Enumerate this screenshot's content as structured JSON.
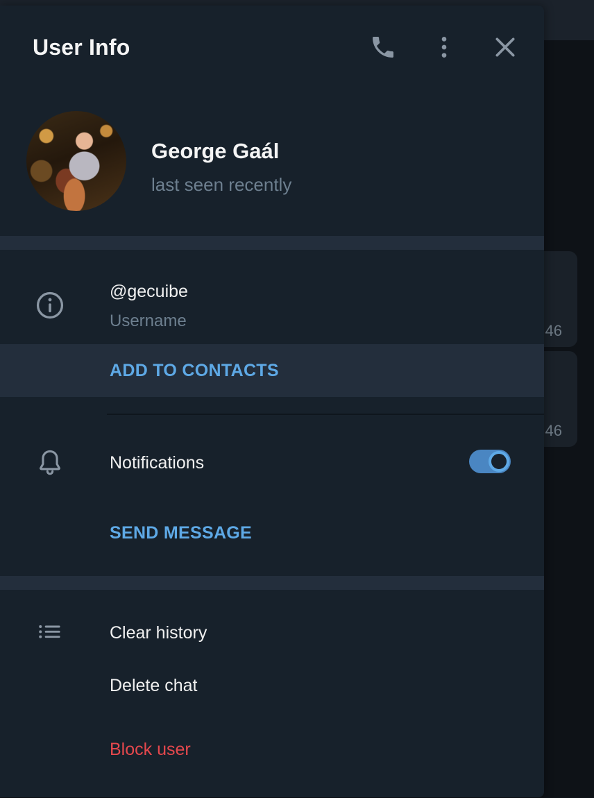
{
  "panel": {
    "title": "User Info",
    "header_icons": [
      "phone-icon",
      "more-vertical-icon",
      "close-icon"
    ]
  },
  "profile": {
    "name": "George Gaál",
    "status": "last seen recently"
  },
  "info": {
    "username": "@gecuibe",
    "username_label": "Username",
    "add_to_contacts": "ADD TO CONTACTS"
  },
  "notifications": {
    "label": "Notifications",
    "enabled": true,
    "send_message": "SEND MESSAGE"
  },
  "actions": {
    "clear_history": "Clear history",
    "delete_chat": "Delete chat",
    "block_user": "Block user"
  },
  "background": {
    "bubble_times": [
      "46",
      "46"
    ]
  },
  "colors": {
    "panel_bg": "#17212b",
    "accent": "#5ea9e6",
    "danger": "#e5484d",
    "secondary_text": "#6d7f8f"
  }
}
